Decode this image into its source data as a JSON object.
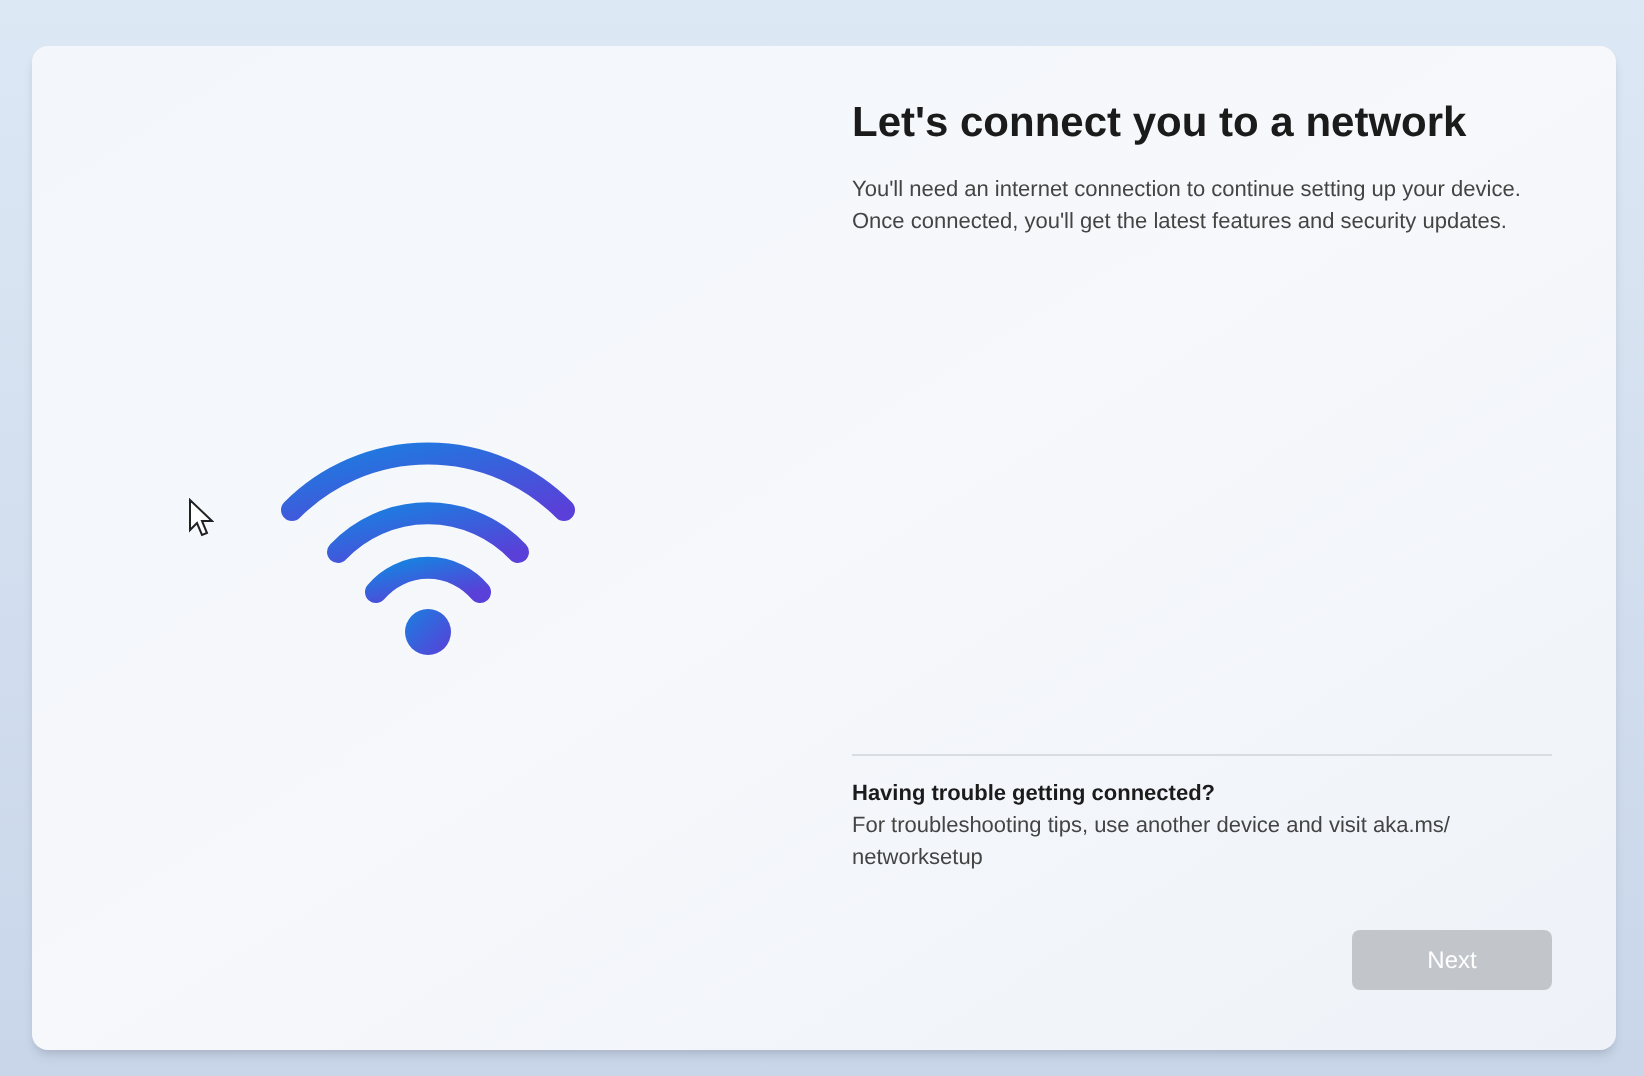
{
  "page": {
    "title": "Let's connect you to a network",
    "description": "You'll need an internet connection to continue setting up your device. Once connected, you'll get the latest features and security updates."
  },
  "help": {
    "heading": "Having trouble getting connected?",
    "text": "For troubleshooting tips, use another device and visit aka.ms/\nnetworksetup"
  },
  "next_button": {
    "label": "Next",
    "disabled": true
  }
}
